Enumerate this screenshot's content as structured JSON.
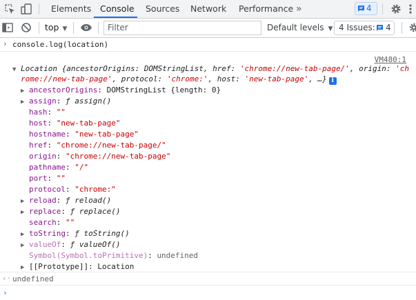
{
  "tabs": [
    "Elements",
    "Console",
    "Sources",
    "Network",
    "Performance"
  ],
  "active_tab": "Console",
  "messages_count": "4",
  "toolbar": {
    "context": "top",
    "filter_placeholder": "Filter",
    "levels_label": "Default levels",
    "issues_label": "4 Issues:",
    "issues_count": "4"
  },
  "console": {
    "command": "console.log(location)",
    "source": "VM480:1",
    "summary_line1": {
      "label": "Location",
      "pre": " {ancestorOrigins: DOMStringList, href: ",
      "href_val": "'chrome://new-tab-page/'",
      "mid": ", origin: ",
      "origin_val": "'ch"
    },
    "summary_line2": {
      "cont": "rome://new-tab-page'",
      "p1": ", protocol: ",
      "protocol_val": "'chrome:'",
      "p2": ", host: ",
      "host_val": "'new-tab-page'",
      "end": ", …}"
    },
    "info_badge": "i",
    "properties": [
      {
        "key": "ancestorOrigins",
        "value": "DOMStringList {length: 0}"
      },
      {
        "key": "assign",
        "value": "ƒ assign()"
      },
      {
        "key": "hash",
        "value": "\"\""
      },
      {
        "key": "host",
        "value": "\"new-tab-page\""
      },
      {
        "key": "hostname",
        "value": "\"new-tab-page\""
      },
      {
        "key": "href",
        "value": "\"chrome://new-tab-page/\""
      },
      {
        "key": "origin",
        "value": "\"chrome://new-tab-page\""
      },
      {
        "key": "pathname",
        "value": "\"/\""
      },
      {
        "key": "port",
        "value": "\"\""
      },
      {
        "key": "protocol",
        "value": "\"chrome:\""
      },
      {
        "key": "reload",
        "value": "ƒ reload()"
      },
      {
        "key": "replace",
        "value": "ƒ replace()"
      },
      {
        "key": "search",
        "value": "\"\""
      },
      {
        "key": "toString",
        "value": "ƒ toString()"
      },
      {
        "key": "valueOf",
        "value": "ƒ valueOf()"
      },
      {
        "key": "Symbol(Symbol.toPrimitive)",
        "value": "undefined"
      },
      {
        "key": "[[Prototype]]",
        "value": "Location"
      }
    ],
    "result": "undefined"
  }
}
